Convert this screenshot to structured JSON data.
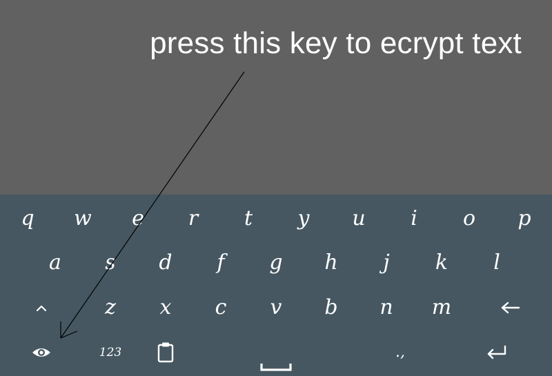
{
  "annotation": {
    "text": "press this key to ecrypt text"
  },
  "keyboard": {
    "row1": [
      "q",
      "w",
      "e",
      "r",
      "t",
      "y",
      "u",
      "i",
      "o",
      "p"
    ],
    "row2": [
      "a",
      "s",
      "d",
      "f",
      "g",
      "h",
      "j",
      "k",
      "l"
    ],
    "row3": [
      "z",
      "x",
      "c",
      "v",
      "b",
      "n",
      "m"
    ],
    "shift_icon": "caret-up-icon",
    "backspace_icon": "left-arrow-icon",
    "encrypt_icon": "eye-icon",
    "numbers_label": "123",
    "clipboard_icon": "clipboard-icon",
    "space_icon": "spacebar-icon",
    "punctuation_label": ".,",
    "enter_icon": "enter-return-icon"
  },
  "colors": {
    "annotation_background": "#616161",
    "keyboard_background": "#465761",
    "key_text": "#ffffff"
  }
}
